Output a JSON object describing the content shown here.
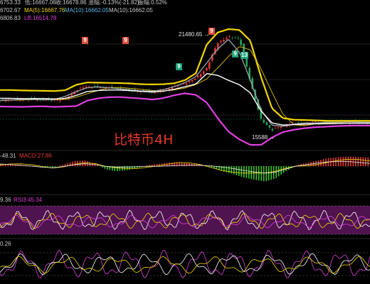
{
  "header": {
    "line1_partial": "6753.33",
    "low": "低:16667.06",
    "close": "收:16678.86",
    "change": "涨幅:-0.13%(-21.82)",
    "amplitude": "振幅:0.52%"
  },
  "legend_ma": {
    "ma_a_partial": "6702.67",
    "ma5": "MA(5):16667.76",
    "ma10": "MA(10):16662.05",
    "ma10b": "MA(10):16662.05"
  },
  "legend_boll": {
    "ub_partial": "6806.83",
    "lb": "LB:16514.78"
  },
  "macd_legend": {
    "dea_partial": "-48.31",
    "macd": "MACD:27.86"
  },
  "rsi_legend": {
    "rsi2_partial": "9.36",
    "rsi3": "RSI3:45.34"
  },
  "kdj_legend": {
    "value_partial": "0.26"
  },
  "annotations": {
    "high_label": "21480.65",
    "low_label": "15588",
    "arrow": "→"
  },
  "signals": {
    "tag_a": "9",
    "tag_b": "9",
    "tag_c": "9",
    "tag_d": "9",
    "tag_e": "9",
    "tag_f": "13"
  },
  "watermark": "比特币4H",
  "colors": {
    "background": "#000000",
    "upper_band": "#f2d600",
    "lower_band": "#e040e0",
    "mid_band": "#ffffff",
    "ma_fast": "#d0d0d0",
    "ma_slow": "#e0c200",
    "candle_up": "#e53935",
    "candle_down": "#26a65b",
    "rsi_fill": "#6a1a6a"
  },
  "chart_data": {
    "type": "line",
    "title": "比特币4H",
    "xlabel": "",
    "ylabel": "",
    "series": [
      {
        "name": "UB",
        "values": [
          18350,
          18350,
          18330,
          18320,
          18310,
          18300,
          18340,
          18620,
          18740,
          18730,
          18720,
          18710,
          18690,
          18650,
          18640,
          18650,
          18700,
          18860,
          19220,
          20700,
          21320,
          21500,
          21450,
          20900,
          19000,
          17400,
          16900,
          16820,
          16800,
          16780,
          16760,
          16760,
          16760,
          16760,
          16760
        ]
      },
      {
        "name": "LB",
        "values": [
          17500,
          17490,
          17480,
          17500,
          17510,
          17480,
          17500,
          17520,
          17800,
          17920,
          17980,
          17990,
          17950,
          17910,
          17860,
          17930,
          18080,
          18180,
          18100,
          17700,
          16900,
          16200,
          15800,
          15520,
          15520,
          15900,
          16180,
          16300,
          16380,
          16430,
          16460,
          16490,
          16510,
          16515,
          16515
        ]
      },
      {
        "name": "Close",
        "values": [
          17800,
          17850,
          17860,
          17880,
          17850,
          17820,
          17900,
          18350,
          18550,
          18500,
          18480,
          18420,
          18350,
          18300,
          18250,
          18320,
          18550,
          18700,
          18950,
          19500,
          20800,
          21100,
          21000,
          18800,
          16800,
          16300,
          16500,
          16650,
          16600,
          16700,
          16650,
          16700,
          16720,
          16690,
          16679
        ]
      }
    ],
    "annotations": [
      {
        "text": "21480.65",
        "value": 21480.65
      },
      {
        "text": "15588",
        "value": 15588
      }
    ],
    "macd": {
      "values": [
        4,
        3,
        2,
        1,
        -1,
        -2,
        3,
        9,
        10,
        4,
        -6,
        -9,
        -7,
        -3,
        2,
        4,
        6,
        7,
        5,
        2,
        -3,
        -9,
        -14,
        -20,
        -24,
        -27,
        -22,
        -9,
        2,
        6,
        10,
        14,
        16,
        17,
        16,
        15
      ]
    },
    "grid": true
  }
}
